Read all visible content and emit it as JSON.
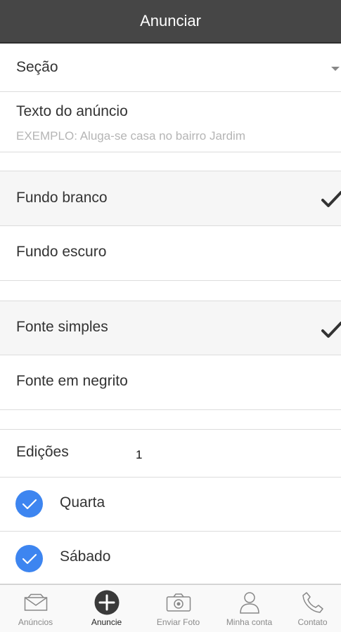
{
  "header": {
    "title": "Anunciar"
  },
  "form": {
    "section_label": "Seção",
    "ad_text_label": "Texto do anúncio",
    "ad_text_placeholder": "EXEMPLO: Aluga-se casa no bairro Jardim",
    "background_options": [
      {
        "label": "Fundo branco",
        "selected": true
      },
      {
        "label": "Fundo escuro",
        "selected": false
      }
    ],
    "font_options": [
      {
        "label": "Fonte simples",
        "selected": true
      },
      {
        "label": "Fonte em negrito",
        "selected": false
      }
    ],
    "editions_label": "Edições",
    "editions_count": "1",
    "days": [
      {
        "label": "Quarta",
        "checked": true
      },
      {
        "label": "Sábado",
        "checked": true
      }
    ]
  },
  "tabbar": {
    "items": [
      {
        "label": "Anúncios",
        "icon": "mail-icon",
        "active": false
      },
      {
        "label": "Anuncie",
        "icon": "add-circle-icon",
        "active": true
      },
      {
        "label": "Enviar Foto",
        "icon": "camera-icon",
        "active": false
      },
      {
        "label": "Minha conta",
        "icon": "user-icon",
        "active": false
      },
      {
        "label": "Contato",
        "icon": "phone-icon",
        "active": false
      }
    ]
  },
  "colors": {
    "header_bg": "#464646",
    "accent_blue": "#3d85f0",
    "selected_row_bg": "#f6f6f6"
  }
}
